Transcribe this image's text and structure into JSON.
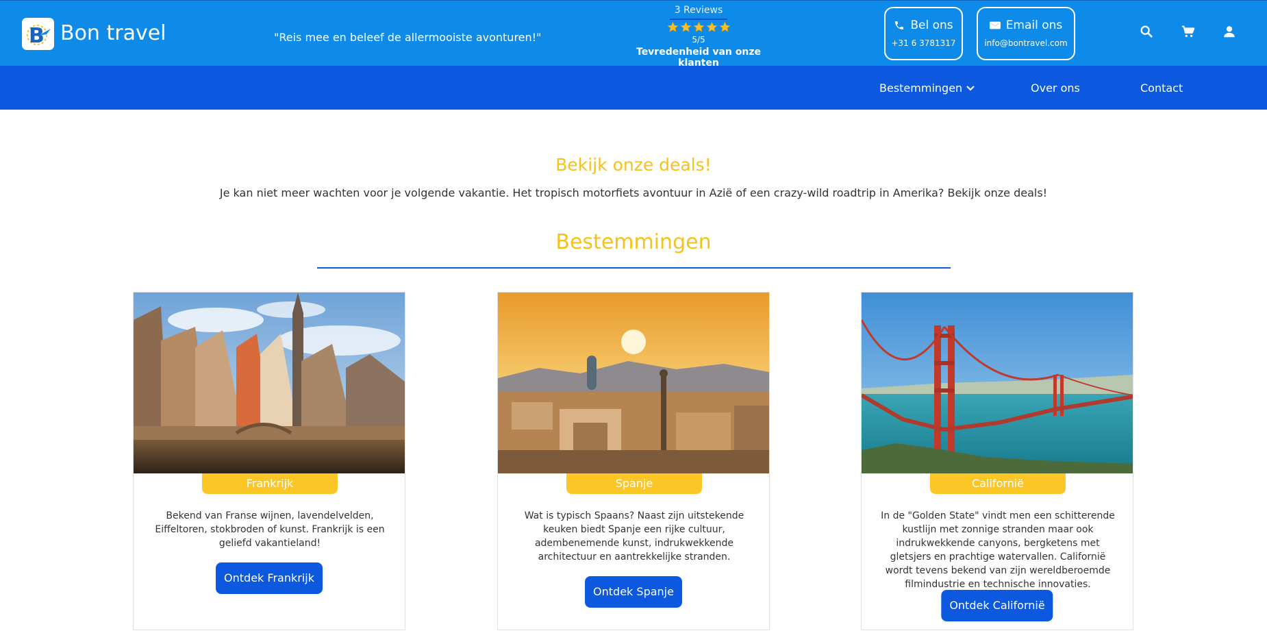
{
  "header": {
    "brand": "Bon travel",
    "tagline": "\"Reis mee en beleef de allermooiste avonturen!\"",
    "reviews": {
      "count_label": "3 Reviews",
      "rating": 5,
      "score_label": "5/5",
      "satisfaction_label": "Tevredenheid van onze klanten"
    },
    "call": {
      "label": "Bel ons",
      "value": "+31 6 3781317"
    },
    "email": {
      "label": "Email ons",
      "value": "info@bontravel.com"
    },
    "icons": [
      "search-icon",
      "cart-icon",
      "user-icon"
    ]
  },
  "nav": {
    "items": [
      {
        "label": "Bestemmingen",
        "has_dropdown": true
      },
      {
        "label": "Over ons"
      },
      {
        "label": "Contact"
      }
    ]
  },
  "deals": {
    "title": "Bekijk onze deals!",
    "text": "Je kan niet meer wachten voor je volgende vakantie. Het tropisch motorfiets avontuur in Azië of een crazy-wild roadtrip in Amerika? Bekijk onze deals!"
  },
  "destinations": {
    "title": "Bestemmingen",
    "cards": [
      {
        "name": "Frankrijk",
        "description": "Bekend van Franse wijnen, lavendelvelden, Eiffeltoren, stokbroden of kunst. Frankrijk is een geliefd vakantieland!",
        "button": "Ontdek Frankrijk"
      },
      {
        "name": "Spanje",
        "description": "Wat is typisch Spaans? Naast zijn uitstekende keuken biedt Spanje een rijke cultuur, adembenemende kunst, indrukwekkende architectuur en aantrekkelijke stranden.",
        "button": "Ontdek Spanje"
      },
      {
        "name": "Californië",
        "description": "In de \"Golden State\" vindt men een schitterende kustlijn met zonnige stranden maar ook indrukwekkende canyons, bergketens met gletsjers en prachtige watervallen. Californië wordt tevens bekend van zijn wereldberoemde filmindustrie en technische innovaties.",
        "button": "Ontdek Californië"
      }
    ]
  },
  "colors": {
    "topbar": "#0e8ae8",
    "navbar": "#0c59e0",
    "accent_yellow": "#f5c11c",
    "badge_yellow": "#fcc726",
    "button_blue": "#0c59e0",
    "star": "#fbc02d"
  }
}
